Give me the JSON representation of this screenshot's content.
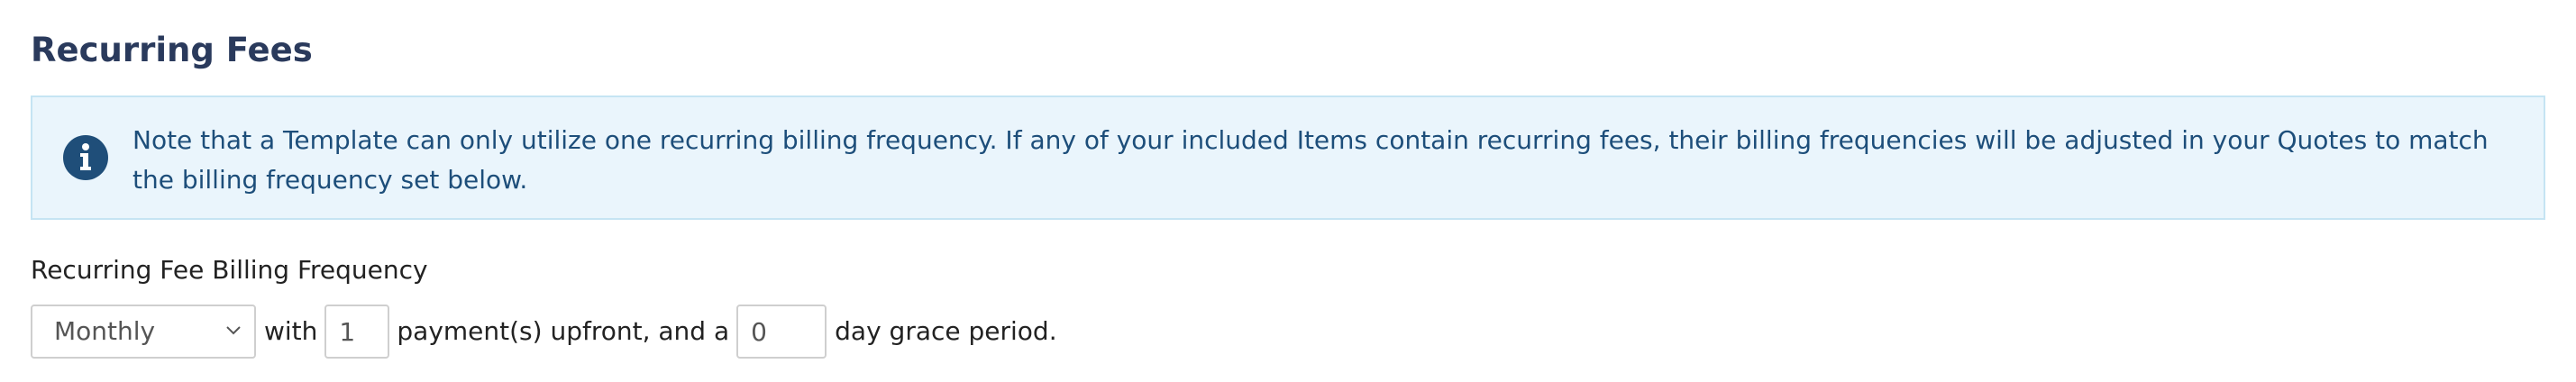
{
  "section": {
    "title": "Recurring Fees"
  },
  "alert": {
    "icon": "info-circle-icon",
    "text": "Note that a Template can only utilize one recurring billing frequency. If any of your included Items contain recurring fees, their billing frequencies will be adjusted in your Quotes to match the billing frequency set below."
  },
  "billing": {
    "label": "Recurring Fee Billing Frequency",
    "frequency_selected": "Monthly",
    "text_with": "with",
    "upfront_payments_value": "1",
    "text_payments": "payment(s) upfront, and a",
    "grace_days_value": "0",
    "text_grace": "day grace period."
  },
  "colors": {
    "title": "#2a3a5c",
    "alert_bg": "#eaf5fc",
    "alert_border": "#c5e4f3",
    "alert_text": "#1d4e7a",
    "alert_icon": "#1f4e79"
  }
}
